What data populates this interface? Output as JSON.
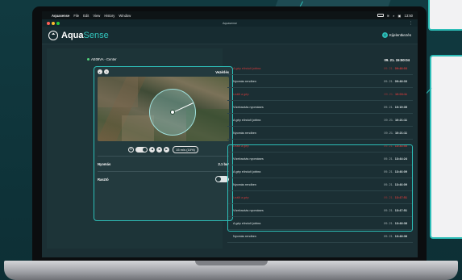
{
  "menubar": {
    "app_name": "Aquasense",
    "items": [
      "File",
      "Edit",
      "View",
      "History",
      "Window"
    ],
    "clock": "13:50"
  },
  "window": {
    "title": "Aquasense"
  },
  "header": {
    "logo_bold": "Aqua",
    "logo_accent": "Sense",
    "logout_label": "Kijelentkezés"
  },
  "device": {
    "name": "AE09VA - Center",
    "mode_label": "Vezérlés",
    "speed_label": "15 m/s (10%)",
    "pressure_label": "Nyomás",
    "pressure_value": "2.1 bar",
    "rinse_label": "Rasztó"
  },
  "events": {
    "timestamp": "09. 21. 15:50:04",
    "rows": [
      {
        "label": "A gép elindult jobbra",
        "prefix": "09. 21.",
        "time": "09:48:03",
        "red": true
      },
      {
        "label": "Nyomás rendben",
        "prefix": "09. 21.",
        "time": "09:48:33",
        "red": false
      },
      {
        "label": "Leállt a gép",
        "prefix": "09. 21.",
        "time": "10:03:11",
        "red": true
      },
      {
        "label": "Vízelosztás nyomáses",
        "prefix": "09. 21.",
        "time": "10:19:35",
        "red": false
      },
      {
        "label": "A gép elindult jobbra",
        "prefix": "09. 21.",
        "time": "10:21:11",
        "red": false
      },
      {
        "label": "Nyomás rendben",
        "prefix": "09. 21.",
        "time": "10:21:11",
        "red": false
      },
      {
        "label": "Leállt a gép",
        "prefix": "09. 21.",
        "time": "13:33:55",
        "red": true
      },
      {
        "label": "Vízelosztás nyomáses",
        "prefix": "09. 21.",
        "time": "13:44:24",
        "red": false
      },
      {
        "label": "A gép elindult jobbra",
        "prefix": "09. 21.",
        "time": "13:46:09",
        "red": false
      },
      {
        "label": "Nyomás rendben",
        "prefix": "09. 21.",
        "time": "13:46:09",
        "red": false
      },
      {
        "label": "Leállt a gép",
        "prefix": "09. 21.",
        "time": "13:47:51",
        "red": true
      },
      {
        "label": "Vízelosztás nyomáses",
        "prefix": "09. 21.",
        "time": "13:47:51",
        "red": false
      },
      {
        "label": "A gép elindult jobbra",
        "prefix": "09. 21.",
        "time": "13:48:38",
        "red": false
      },
      {
        "label": "Nyomás rendben",
        "prefix": "09. 21.",
        "time": "13:48:38",
        "red": false
      }
    ]
  },
  "colors": {
    "accent": "#2dbdb7",
    "alert": "#d03a3a",
    "background": "#10343a"
  }
}
